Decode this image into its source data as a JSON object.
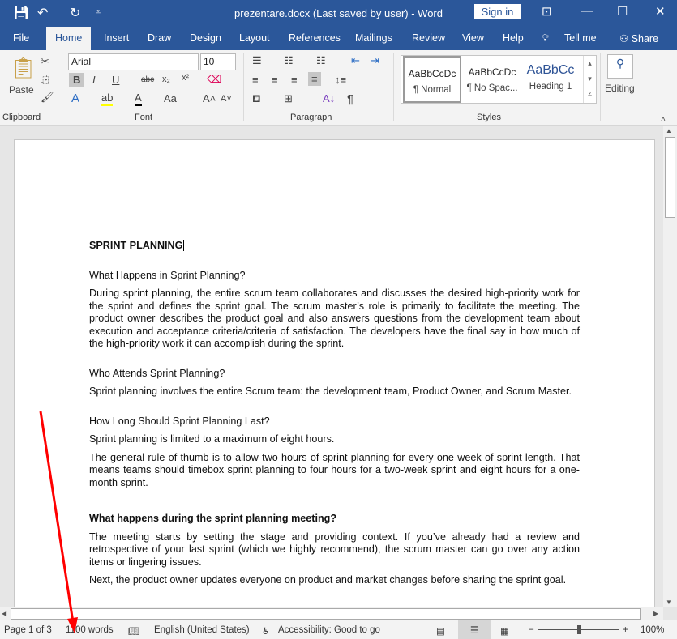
{
  "window": {
    "title": "prezentare.docx (Last saved by user)  -  Word",
    "sign_in": "Sign in"
  },
  "tabs": [
    "File",
    "Home",
    "Insert",
    "Draw",
    "Design",
    "Layout",
    "References",
    "Mailings",
    "Review",
    "View",
    "Help",
    "Tell me",
    "Share"
  ],
  "ribbon": {
    "font_name": "Arial",
    "font_size": "10",
    "paste": "Paste",
    "groups": {
      "clipboard": "Clipboard",
      "font": "Font",
      "paragraph": "Paragraph",
      "styles": "Styles"
    },
    "styles": [
      {
        "preview": "AaBbCcDc",
        "name": "¶ Normal"
      },
      {
        "preview": "AaBbCcDc",
        "name": "¶ No Spac..."
      },
      {
        "preview": "AaBbCc",
        "name": "Heading 1"
      }
    ],
    "editing": "Editing"
  },
  "document": {
    "title": "SPRINT PLANNING",
    "sections": [
      {
        "heading": "What Happens in Sprint Planning?",
        "paragraphs": [
          "During sprint planning, the entire scrum team collaborates and discusses the desired high-priority work for the sprint and defines the sprint goal. The scrum master’s role is primarily to facilitate the meeting. The product owner describes the product goal and also answers questions from the development team about execution and acceptance criteria/criteria of satisfaction.  The developers have the final say in how much of the high-priority work it can accomplish during the sprint."
        ]
      },
      {
        "heading": "Who Attends Sprint Planning?",
        "paragraphs": [
          "Sprint planning involves the entire Scrum team: the development team, Product Owner, and Scrum Master."
        ]
      },
      {
        "heading": "How Long Should Sprint Planning Last?",
        "paragraphs": [
          "Sprint planning is limited to a maximum of eight hours.",
          "The general rule of thumb is to allow two hours of sprint planning for every one week of sprint length. That means teams should timebox sprint planning to four hours for a two-week sprint and eight hours for a one-month sprint."
        ]
      },
      {
        "heading": "What happens during the sprint planning meeting?",
        "paragraphs": [
          "The meeting starts by setting the stage and providing context. If you’ve already had a review and retrospective of your last sprint (which we highly recommend), the scrum master can go over any action items or lingering issues.",
          "Next, the product owner updates everyone on product and market changes before sharing the sprint goal."
        ]
      }
    ]
  },
  "status": {
    "page": "Page 1 of 3",
    "words": "1100 words",
    "language": "English (United States)",
    "accessibility": "Accessibility: Good to go",
    "zoom": "100%",
    "zoom_level_percent": 100
  },
  "annotation": {
    "color": "#ff0000",
    "icon": "red-arrow-pointing-to-word-count"
  }
}
